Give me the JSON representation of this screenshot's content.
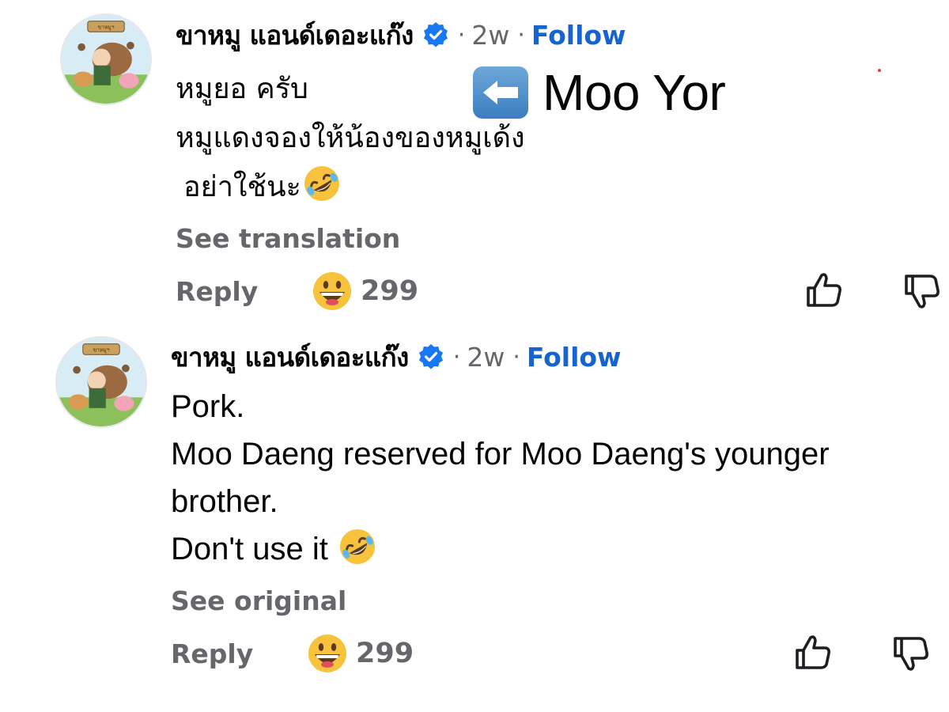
{
  "comments": [
    {
      "author": "ขาหมู แอนด์เดอะแก๊ง",
      "separator": "·",
      "time": "2w",
      "time_follow_separator": "·",
      "follow_label": "Follow",
      "body_lines": [
        "หมูยอ ครับ",
        "หมูแดงจองให้น้องของหมูเด้ง",
        "อย่าใช้นะ"
      ],
      "translate_label": "See translation",
      "reply_label": "Reply",
      "reaction_count": "299",
      "annotation": {
        "icon": "left-arrow-emoji-icon",
        "text": "Moo Yor"
      },
      "avatar_sign": "ขาหมูฯ"
    },
    {
      "author": "ขาหมู แอนด์เดอะแก๊ง",
      "separator": "·",
      "time": "2w",
      "time_follow_separator": "·",
      "follow_label": "Follow",
      "body_lines": [
        "Pork.",
        "Moo Daeng reserved for Moo Daeng's younger",
        "brother.",
        "Don't use it"
      ],
      "translate_label": "See original",
      "reply_label": "Reply",
      "reaction_count": "299",
      "avatar_sign": "ขาหมูฯ"
    }
  ],
  "icons": {
    "verified": "verified-badge-icon",
    "reaction": "grinning-face-emoji-icon",
    "inline": "rolling-on-floor-laughing-emoji-icon",
    "like": "thumbs-up-icon",
    "dislike": "thumbs-down-icon"
  },
  "colors": {
    "follow": "#1763cf",
    "verified": "#1877f2",
    "secondary_text": "#65676b"
  }
}
